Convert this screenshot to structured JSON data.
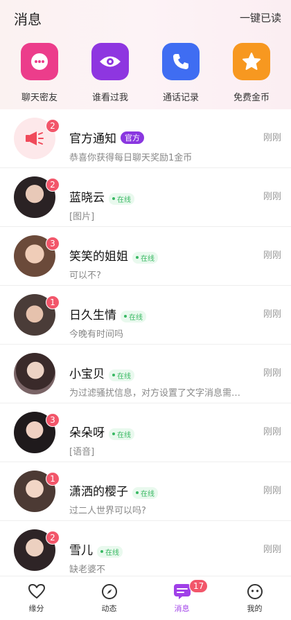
{
  "header": {
    "title": "消息",
    "mark_all_read": "一键已读"
  },
  "quick_actions": [
    {
      "label": "聊天密友",
      "icon": "chat-bubble-icon",
      "color": "#ec3d8b"
    },
    {
      "label": "谁看过我",
      "icon": "eye-icon",
      "color": "#8e36e0"
    },
    {
      "label": "通话记录",
      "icon": "phone-icon",
      "color": "#3f6df2"
    },
    {
      "label": "免费金币",
      "icon": "star-icon",
      "color": "#f79820"
    }
  ],
  "status": {
    "online": "在线",
    "official": "官方"
  },
  "conversations": [
    {
      "name": "官方通知",
      "tag": "官方",
      "preview": "恭喜你获得每日聊天奖励1金币",
      "time": "刚刚",
      "unread": "2",
      "avatar": "megaphone-icon"
    },
    {
      "name": "蓝晓云",
      "preview": "[图片]",
      "time": "刚刚",
      "unread": "2"
    },
    {
      "name": "笑笑的姐姐",
      "preview": "可以不?",
      "time": "刚刚",
      "unread": "3"
    },
    {
      "name": "日久生情",
      "preview": "今晚有时间吗",
      "time": "刚刚",
      "unread": "1"
    },
    {
      "name": "小宝贝",
      "preview": "为过滤骚扰信息，对方设置了文字消息需付费",
      "time": "刚刚",
      "unread": ""
    },
    {
      "name": "朵朵呀",
      "preview": "[语音]",
      "time": "刚刚",
      "unread": "3"
    },
    {
      "name": "潇洒的樱子",
      "preview": "过二人世界可以吗?",
      "time": "刚刚",
      "unread": "1"
    },
    {
      "name": "雪儿",
      "preview": "缺老婆不",
      "time": "刚刚",
      "unread": "2"
    }
  ],
  "tabbar": {
    "tabs": [
      {
        "label": "缘分",
        "icon": "heart-icon"
      },
      {
        "label": "动态",
        "icon": "compass-icon"
      },
      {
        "label": "消息",
        "icon": "message-icon",
        "badge": "17"
      },
      {
        "label": "我的",
        "icon": "smile-face-icon"
      }
    ],
    "active_color": "#a040e8"
  }
}
